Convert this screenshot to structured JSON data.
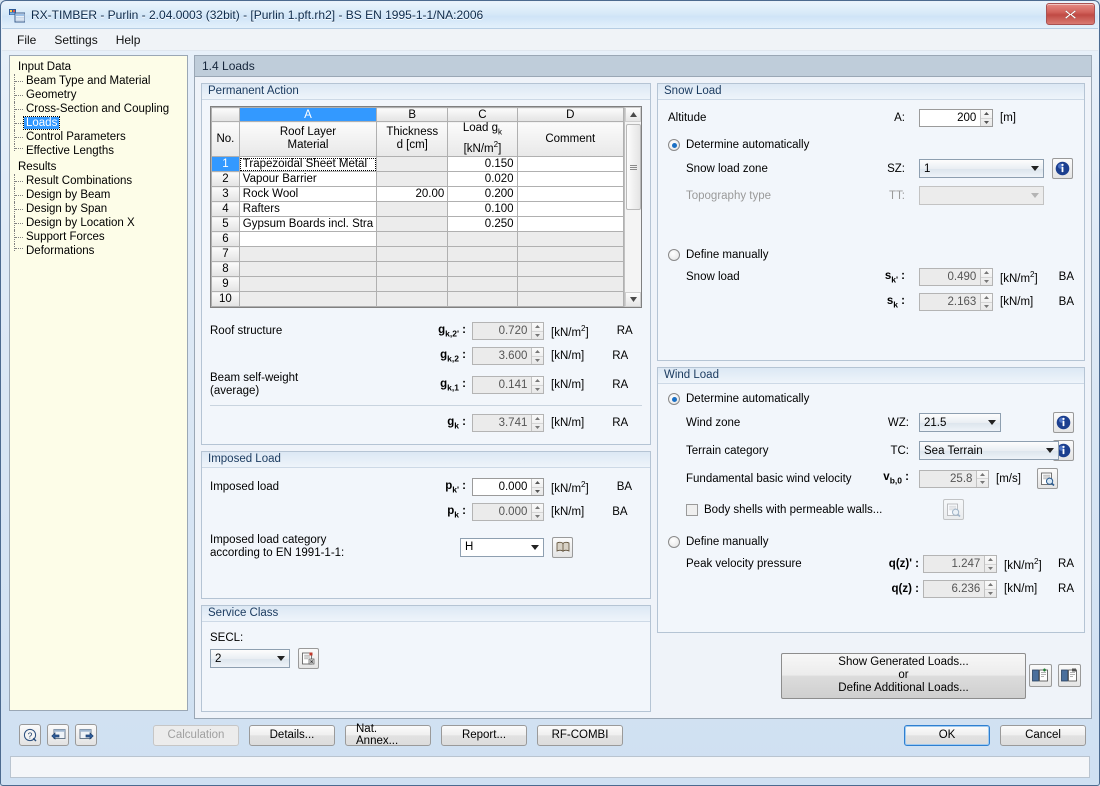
{
  "window": {
    "title": "RX-TIMBER - Purlin - 2.04.0003 (32bit) - [Purlin 1.pft.rh2] - BS EN 1995-1-1/NA:2006",
    "close_label": "Close"
  },
  "menu": {
    "items": [
      "File",
      "Settings",
      "Help"
    ]
  },
  "sidebar": {
    "groups": [
      {
        "label": "Input Data",
        "items": [
          "Beam Type and Material",
          "Geometry",
          "Cross-Section and Coupling",
          "Loads",
          "Control Parameters",
          "Effective Lengths"
        ],
        "selected": "Loads"
      },
      {
        "label": "Results",
        "items": [
          "Result Combinations",
          "Design by Beam",
          "Design by Span",
          "Design by Location X",
          "Support Forces",
          "Deformations"
        ],
        "selected": ""
      }
    ]
  },
  "tab": {
    "title": "1.4 Loads"
  },
  "permanent_action": {
    "title": "Permanent Action",
    "col_letters": [
      "A",
      "B",
      "C",
      "D"
    ],
    "headers": [
      {
        "line1": "No.",
        "line2": ""
      },
      {
        "line1": "Roof Layer",
        "line2": "Material"
      },
      {
        "line1": "Thickness",
        "line2": "d [cm]"
      },
      {
        "line1": "Load g",
        "sub": "k",
        "line2": "[kN/m",
        "sup": "2",
        "line2b": "]"
      },
      {
        "line1": "",
        "line2": "Comment"
      }
    ],
    "rows": [
      {
        "no": "1",
        "material": "Trapezoidal Sheet Metal",
        "thickness": "",
        "load": "0.150",
        "comment": ""
      },
      {
        "no": "2",
        "material": "Vapour Barrier",
        "thickness": "",
        "load": "0.020",
        "comment": ""
      },
      {
        "no": "3",
        "material": "Rock Wool",
        "thickness": "20.00",
        "load": "0.200",
        "comment": ""
      },
      {
        "no": "4",
        "material": "Rafters",
        "thickness": "",
        "load": "0.100",
        "comment": ""
      },
      {
        "no": "5",
        "material": "Gypsum Boards incl. Stra",
        "thickness": "",
        "load": "0.250",
        "comment": ""
      },
      {
        "no": "6",
        "material": "",
        "thickness": "",
        "load": "",
        "comment": ""
      },
      {
        "no": "7",
        "material": "",
        "thickness": "",
        "load": "",
        "comment": ""
      },
      {
        "no": "8",
        "material": "",
        "thickness": "",
        "load": "",
        "comment": ""
      },
      {
        "no": "9",
        "material": "",
        "thickness": "",
        "load": "",
        "comment": ""
      },
      {
        "no": "10",
        "material": "",
        "thickness": "",
        "load": "",
        "comment": ""
      }
    ],
    "summary": {
      "roof_structure_label": "Roof structure",
      "beam_selfweight_label": "Beam self-weight",
      "beam_selfweight_label2": "(average)",
      "fields": [
        {
          "sym": "g",
          "sub": "k,2'",
          "value": "0.720",
          "unit": "[kN/m",
          "unit_sup": "2",
          "unit_end": "]",
          "tag": "RA",
          "readonly": true
        },
        {
          "sym": "g",
          "sub": "k,2",
          "value": "3.600",
          "unit": "[kN/m]",
          "unit_sup": "",
          "unit_end": "",
          "tag": "RA",
          "readonly": true
        },
        {
          "sym": "g",
          "sub": "k,1",
          "value": "0.141",
          "unit": "[kN/m]",
          "unit_sup": "",
          "unit_end": "",
          "tag": "RA",
          "readonly": true
        },
        {
          "sym": "g",
          "sub": "k",
          "value": "3.741",
          "unit": "[kN/m]",
          "unit_sup": "",
          "unit_end": "",
          "tag": "RA",
          "readonly": true
        }
      ]
    }
  },
  "imposed_load": {
    "title": "Imposed Load",
    "label": "Imposed load",
    "fields": [
      {
        "sym": "p",
        "sub": "k'",
        "value": "0.000",
        "unit": "[kN/m",
        "unit_sup": "2",
        "unit_end": "]",
        "tag": "BA",
        "readonly": false
      },
      {
        "sym": "p",
        "sub": "k",
        "value": "0.000",
        "unit": "[kN/m]",
        "unit_sup": "",
        "unit_end": "",
        "tag": "BA",
        "readonly": true
      }
    ],
    "category_label_l1": "Imposed load category",
    "category_label_l2": "according to EN 1991-1-1:",
    "category_value": "H"
  },
  "service_class": {
    "title": "Service Class",
    "label": "SECL:",
    "value": "2"
  },
  "snow_load": {
    "title": "Snow Load",
    "altitude_label": "Altitude",
    "altitude_sym": "A:",
    "altitude_value": "200",
    "altitude_unit": "[m]",
    "auto_label": "Determine automatically",
    "zone_label": "Snow load zone",
    "zone_sym": "SZ:",
    "zone_value": "1",
    "topo_label": "Topography type",
    "topo_sym": "TT:",
    "topo_value": "",
    "manual_label": "Define manually",
    "snow_label": "Snow load",
    "fields": [
      {
        "sym": "s",
        "sub": "k'",
        "value": "0.490",
        "unit": "[kN/m",
        "unit_sup": "2",
        "unit_end": "]",
        "tag": "BA",
        "readonly": true
      },
      {
        "sym": "s",
        "sub": "k",
        "value": "2.163",
        "unit": "[kN/m]",
        "unit_sup": "",
        "unit_end": "",
        "tag": "BA",
        "readonly": true
      }
    ]
  },
  "wind_load": {
    "title": "Wind Load",
    "auto_label": "Determine automatically",
    "zone_label": "Wind zone",
    "zone_sym": "WZ:",
    "zone_value": "21.5",
    "terrain_label": "Terrain category",
    "terrain_sym": "TC:",
    "terrain_value": "Sea Terrain",
    "velocity_label": "Fundamental basic wind velocity",
    "velocity_sym": "v",
    "velocity_sub": "b,0",
    "velocity_value": "25.8",
    "velocity_unit": "[m/s]",
    "permeable_label": "Body shells with permeable walls...",
    "permeable_checked": false,
    "manual_label": "Define manually",
    "peak_label": "Peak velocity pressure",
    "fields": [
      {
        "sym": "q(z)'",
        "sub": "",
        "value": "1.247",
        "unit": "[kN/m",
        "unit_sup": "2",
        "unit_end": "]",
        "tag": "RA",
        "readonly": true
      },
      {
        "sym": "q(z)",
        "sub": "",
        "value": "6.236",
        "unit": "[kN/m]",
        "unit_sup": "",
        "unit_end": "",
        "tag": "RA",
        "readonly": true
      }
    ]
  },
  "generated_loads": {
    "line1": "Show Generated Loads...",
    "line2": "or",
    "line3": "Define Additional Loads..."
  },
  "footer": {
    "buttons": [
      "Calculation",
      "Details...",
      "Nat. Annex...",
      "Report...",
      "RF-COMBI"
    ],
    "calculation_disabled": true,
    "ok": "OK",
    "cancel": "Cancel"
  },
  "colors": {
    "accent": "#3399ff",
    "title_text": "#0d2a4a",
    "group_title": "#1a3a5f",
    "close_btn": "#c04a44"
  }
}
